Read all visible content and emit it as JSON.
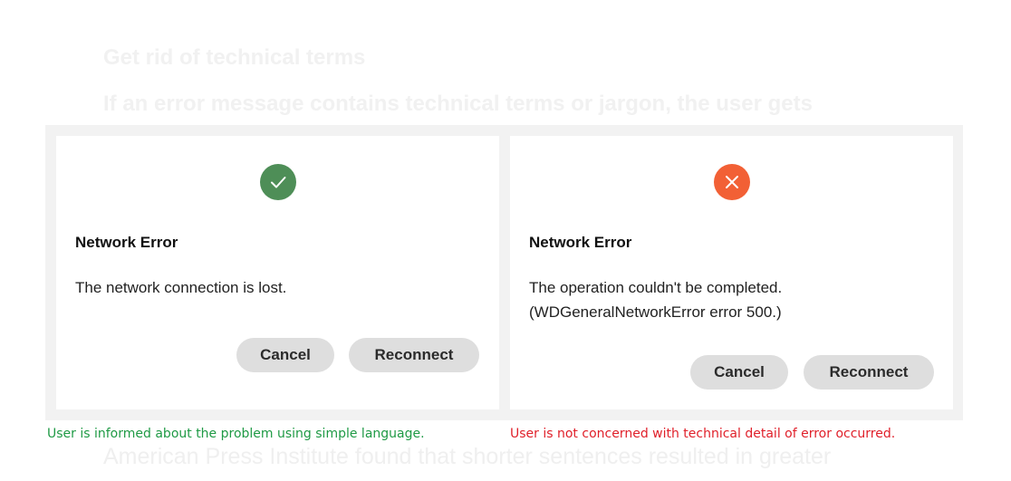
{
  "background": {
    "heading": "Get rid of technical terms",
    "paragraph": "If an error message contains technical terms or jargon, the user gets",
    "footer_text": "American Press Institute found that shorter sentences resulted in greater"
  },
  "good_example": {
    "icon": "checkmark-icon",
    "icon_color": "#4e8e57",
    "title": "Network Error",
    "message_lines": [
      "The network connection is lost."
    ],
    "cancel_label": "Cancel",
    "reconnect_label": "Reconnect",
    "caption": "User is informed about the problem using simple language.",
    "caption_color": "#1f9a45"
  },
  "bad_example": {
    "icon": "cross-icon",
    "icon_color": "#f26035",
    "title": "Network Error",
    "message_lines": [
      "The operation couldn't be completed.",
      "(WDGeneralNetworkError error 500.)"
    ],
    "cancel_label": "Cancel",
    "reconnect_label": "Reconnect",
    "caption": "User is not concerned with technical detail of error occurred.",
    "caption_color": "#e0202a"
  }
}
